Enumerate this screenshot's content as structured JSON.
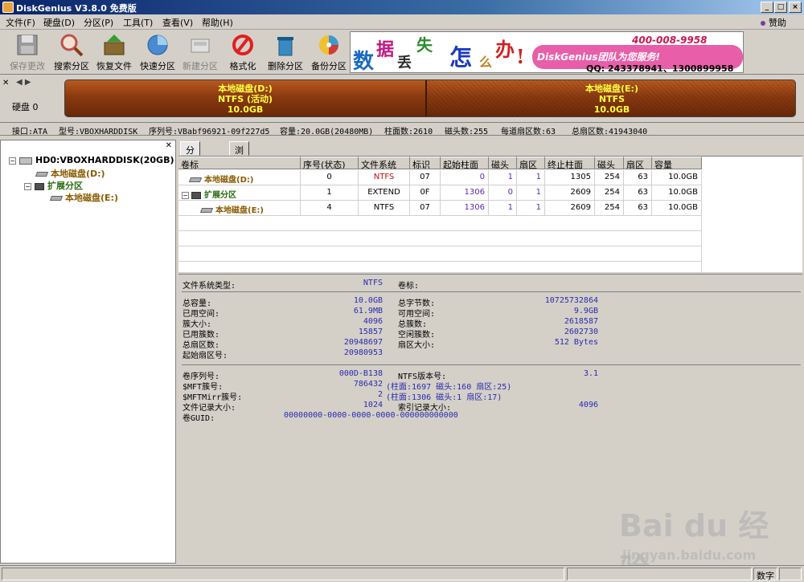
{
  "window": {
    "title": "DiskGenius V3.8.0 免费版"
  },
  "menu": {
    "items": [
      "文件(F)",
      "硬盘(D)",
      "分区(P)",
      "工具(T)",
      "查看(V)",
      "帮助(H)"
    ],
    "right": "赞助"
  },
  "toolbar": {
    "items": [
      "保存更改",
      "搜索分区",
      "恢复文件",
      "快速分区",
      "新建分区",
      "格式化",
      "删除分区",
      "备份分区"
    ]
  },
  "banner": {
    "chars": [
      "数",
      "据",
      "丢",
      "失",
      "怎",
      "么",
      "办",
      "!"
    ],
    "team": "DiskGenius团队为您服务!",
    "phone": "400-008-9958",
    "qq": "QQ: 243378941、1300899958"
  },
  "diskbar": {
    "disk_label": "硬盘 0",
    "partitions": [
      {
        "name": "本地磁盘(D:)",
        "fs": "NTFS (活动)",
        "size": "10.0GB"
      },
      {
        "name": "本地磁盘(E:)",
        "fs": "NTFS",
        "size": "10.0GB"
      }
    ]
  },
  "diskinfo": {
    "interface": "接口:ATA",
    "model": "型号:VBOXHARDDISK",
    "serial": "序列号:VBabf96921-09f227d5",
    "capacity": "容量:20.0GB(20480MB)",
    "cylinders": "柱面数:2610",
    "heads": "磁头数:255",
    "sectors_per_track": "每道扇区数:63",
    "total_sectors": "总扇区数:41943040"
  },
  "tree": {
    "disk": "HD0:VBOXHARDDISK(20GB)",
    "d": "本地磁盘(D:)",
    "ext": "扩展分区",
    "e": "本地磁盘(E:)"
  },
  "tabs": [
    "分区参数",
    "浏览文件"
  ],
  "table": {
    "headers": [
      "卷标",
      "序号(状态)",
      "文件系统",
      "标识",
      "起始柱面",
      "磁头",
      "扇区",
      "终止柱面",
      "磁头",
      "扇区",
      "容量"
    ],
    "rows": [
      [
        "本地磁盘(D:)",
        "0",
        "NTFS",
        "07",
        "0",
        "1",
        "1",
        "1305",
        "254",
        "63",
        "10.0GB"
      ],
      [
        "扩展分区",
        "1",
        "EXTEND",
        "0F",
        "1306",
        "0",
        "1",
        "2609",
        "254",
        "63",
        "10.0GB"
      ],
      [
        "本地磁盘(E:)",
        "4",
        "NTFS",
        "07",
        "1306",
        "1",
        "1",
        "2609",
        "254",
        "63",
        "10.0GB"
      ]
    ]
  },
  "details": {
    "fs_type_label": "文件系统类型:",
    "fs_type": "NTFS",
    "vol_label": "卷标:",
    "left": [
      [
        "总容量:",
        "10.0GB"
      ],
      [
        "已用空间:",
        "61.9MB"
      ],
      [
        "簇大小:",
        "4096"
      ],
      [
        "已用簇数:",
        "15857"
      ],
      [
        "总扇区数:",
        "20948697"
      ],
      [
        "起始扇区号:",
        "20980953"
      ]
    ],
    "right": [
      [
        "总字节数:",
        "10725732864"
      ],
      [
        "可用空间:",
        "9.9GB"
      ],
      [
        "总簇数:",
        "2618587"
      ],
      [
        "空闲簇数:",
        "2602730"
      ],
      [
        "扇区大小:",
        "512 Bytes"
      ]
    ],
    "serial_label": "卷序列号:",
    "serial": "000D-B138",
    "ntfs_ver_label": "NTFS版本号:",
    "ntfs_ver": "3.1",
    "mft_label": "$MFT簇号:",
    "mft": "786432",
    "mft_loc": "(柱面:1697 磁头:160 扇区:25)",
    "mftmirr_label": "$MFTMirr簇号:",
    "mftmirr": "2",
    "mftmirr_loc": "(柱面:1306 磁头:1 扇区:17)",
    "rec_label": "文件记录大小:",
    "rec": "1024",
    "idx_label": "索引记录大小:",
    "idx": "4096",
    "guid_label": "卷GUID:",
    "guid": "00000000-0000-0000-0000-000000000000"
  },
  "status": {
    "numlock": "数字"
  },
  "watermark": {
    "brand": "Bai du 经验",
    "url": "jingyan.baidu.com"
  },
  "colors": {
    "partition_bar": "#8a3a10",
    "partition_text": "#ffff40",
    "volume_label": "#8a5a00",
    "value": "#5a2ab0"
  }
}
